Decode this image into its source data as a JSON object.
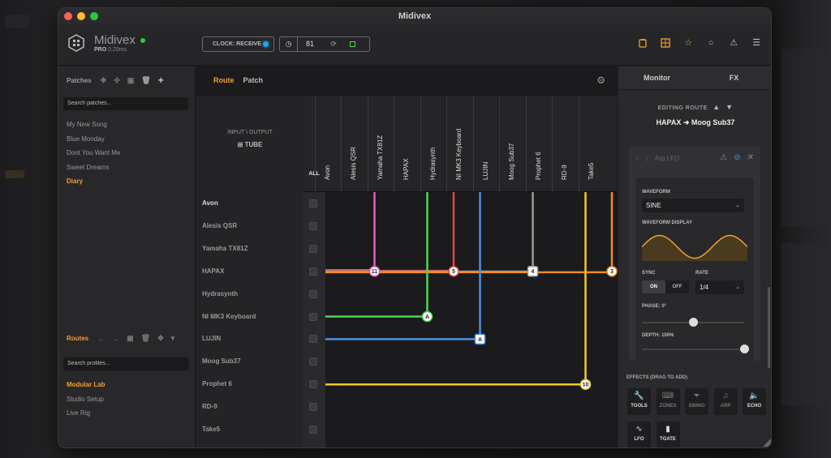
{
  "window": {
    "title": "Midivex"
  },
  "header": {
    "app_name": "Midivex",
    "edition": "PRO",
    "latency": "0.20ms",
    "clock_label": "CLOCK: RECEIVE",
    "bpm": "81",
    "icons": [
      "clipboard-icon",
      "grid-icon",
      "star-icon",
      "circle-icon",
      "warning-icon",
      "menu-icon"
    ]
  },
  "patches": {
    "title": "Patches",
    "search_placeholder": "Search patches...",
    "items": [
      "My New Song",
      "Blue Monday",
      "Dont You Want Me",
      "Sweet Dreams",
      "Diary"
    ],
    "active_index": 4
  },
  "routes": {
    "title": "Routes",
    "search_placeholder": "Search profiles...",
    "items": [
      "Modular Lab",
      "Studio Setup",
      "Live Rig"
    ],
    "active_index": 0
  },
  "center": {
    "tabs": [
      "Route",
      "Patch"
    ],
    "active_tab": 0,
    "corner_label": "INPUT \\ OUTPUT",
    "corner_device": "TUBE",
    "all_label": "ALL",
    "columns": [
      "Avon",
      "Alesis QSR",
      "Yamaha TX81Z",
      "HAPAX",
      "Hydrasynth",
      "NI MK3 Keyboard",
      "LUJIN",
      "Moog Sub37",
      "Prophet 6",
      "RD-9",
      "Take5"
    ],
    "rows": [
      "Avon",
      "Alesis QSR",
      "Yamaha TX81Z",
      "HAPAX",
      "Hydrasynth",
      "NI MK3 Keyboard",
      "LUJIN",
      "Moog Sub37",
      "Prophet 6",
      "RD-9",
      "Take5"
    ],
    "routes": [
      {
        "row": 3,
        "col": 1,
        "color": "#e05cc0",
        "label": "11",
        "shape": "circle"
      },
      {
        "row": 3,
        "col": 4,
        "color": "#e04848",
        "label": "5",
        "shape": "circle"
      },
      {
        "row": 3,
        "col": 7,
        "color": "#9a9a9a",
        "label": "4",
        "shape": "square"
      },
      {
        "row": 3,
        "col": 10,
        "color": "#f08a24",
        "label": "3",
        "shape": "circle"
      },
      {
        "row": 5,
        "col": 3,
        "color": "#4fd64f",
        "label": "A",
        "shape": "circle"
      },
      {
        "row": 6,
        "col": 5,
        "color": "#4a90e2",
        "label": "A",
        "shape": "square"
      },
      {
        "row": 8,
        "col": 9,
        "color": "#f0c830",
        "label": "10",
        "shape": "circle"
      }
    ]
  },
  "right": {
    "tabs": [
      "Monitor",
      "FX"
    ],
    "editing_label": "EDITING ROUTE",
    "route_name": "HAPAX ➜ Moog Sub37",
    "fx_name": "Arp LFO",
    "waveform_label": "WAVEFORM",
    "waveform_value": "SINE",
    "waveform_display_label": "WAVEFORM DISPLAY",
    "sync_label": "SYNC",
    "sync_on": "ON",
    "sync_off": "OFF",
    "rate_label": "RATE",
    "rate_value": "1/4",
    "phase_label": "PHASE: 0°",
    "phase_value": 0.5,
    "depth_label": "DEPTH: 100%",
    "depth_value": 1.0,
    "effects_label": "EFFECTS (DRAG TO ADD)",
    "effects": [
      {
        "label": "TOOLS",
        "icon": "wrench-icon",
        "dim": false
      },
      {
        "label": "ZONES",
        "icon": "keyboard-icon",
        "dim": true
      },
      {
        "label": "SWING",
        "icon": "metronome-icon",
        "dim": true
      },
      {
        "label": "ARP",
        "icon": "note-icon",
        "dim": true
      },
      {
        "label": "ECHO",
        "icon": "speaker-icon",
        "dim": false
      },
      {
        "label": "LFO",
        "icon": "wave-icon",
        "dim": false
      },
      {
        "label": "TGATE",
        "icon": "gate-icon",
        "dim": false
      }
    ],
    "accent": "#f0a030"
  }
}
